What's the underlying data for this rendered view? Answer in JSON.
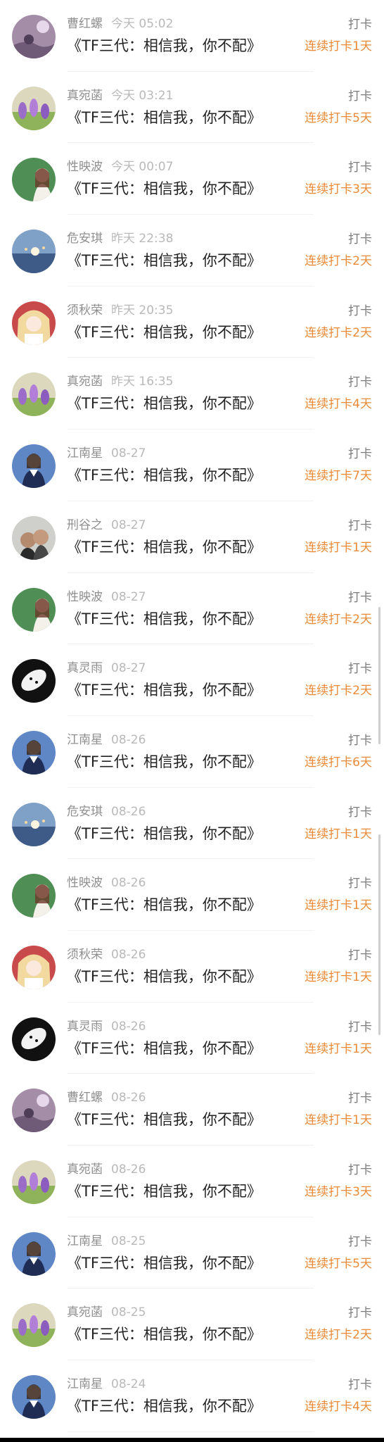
{
  "items": [
    {
      "name": "曹红螺",
      "time": "今天 05:02",
      "title": "《TF三代：相信我，你不配》",
      "action": "打卡",
      "streak": "连续打卡1天",
      "avatar": "avatar-purple-night-icon"
    },
    {
      "name": "真宛菡",
      "time": "今天 03:21",
      "title": "《TF三代：相信我，你不配》",
      "action": "打卡",
      "streak": "连续打卡5天",
      "avatar": "avatar-crocus-flowers-icon"
    },
    {
      "name": "性映波",
      "time": "今天 00:07",
      "title": "《TF三代：相信我，你不配》",
      "action": "打卡",
      "streak": "连续打卡3天",
      "avatar": "avatar-green-portrait-icon"
    },
    {
      "name": "危安琪",
      "time": "昨天 22:38",
      "title": "《TF三代：相信我，你不配》",
      "action": "打卡",
      "streak": "连续打卡2天",
      "avatar": "avatar-blue-sky-icon"
    },
    {
      "name": "须秋荣",
      "time": "昨天 20:35",
      "title": "《TF三代：相信我，你不配》",
      "action": "打卡",
      "streak": "连续打卡2天",
      "avatar": "avatar-anime-girl-icon"
    },
    {
      "name": "真宛菡",
      "time": "昨天 16:35",
      "title": "《TF三代：相信我，你不配》",
      "action": "打卡",
      "streak": "连续打卡4天",
      "avatar": "avatar-crocus-flowers-icon"
    },
    {
      "name": "江南星",
      "time": "08-27",
      "title": "《TF三代：相信我，你不配》",
      "action": "打卡",
      "streak": "连续打卡7天",
      "avatar": "avatar-uniform-girl-icon"
    },
    {
      "name": "刑谷之",
      "time": "08-27",
      "title": "《TF三代：相信我，你不配》",
      "action": "打卡",
      "streak": "连续打卡1天",
      "avatar": "avatar-couple-photo-icon"
    },
    {
      "name": "性映波",
      "time": "08-27",
      "title": "《TF三代：相信我，你不配》",
      "action": "打卡",
      "streak": "连续打卡2天",
      "avatar": "avatar-green-portrait-icon"
    },
    {
      "name": "真灵雨",
      "time": "08-27",
      "title": "《TF三代：相信我，你不配》",
      "action": "打卡",
      "streak": "连续打卡2天",
      "avatar": "avatar-black-white-icon"
    },
    {
      "name": "江南星",
      "time": "08-26",
      "title": "《TF三代：相信我，你不配》",
      "action": "打卡",
      "streak": "连续打卡6天",
      "avatar": "avatar-uniform-girl-icon"
    },
    {
      "name": "危安琪",
      "time": "08-26",
      "title": "《TF三代：相信我，你不配》",
      "action": "打卡",
      "streak": "连续打卡1天",
      "avatar": "avatar-blue-sky-icon"
    },
    {
      "name": "性映波",
      "time": "08-26",
      "title": "《TF三代：相信我，你不配》",
      "action": "打卡",
      "streak": "连续打卡1天",
      "avatar": "avatar-green-portrait-icon"
    },
    {
      "name": "须秋荣",
      "time": "08-26",
      "title": "《TF三代：相信我，你不配》",
      "action": "打卡",
      "streak": "连续打卡1天",
      "avatar": "avatar-anime-girl-icon"
    },
    {
      "name": "真灵雨",
      "time": "08-26",
      "title": "《TF三代：相信我，你不配》",
      "action": "打卡",
      "streak": "连续打卡1天",
      "avatar": "avatar-black-white-icon"
    },
    {
      "name": "曹红螺",
      "time": "08-26",
      "title": "《TF三代：相信我，你不配》",
      "action": "打卡",
      "streak": "连续打卡1天",
      "avatar": "avatar-purple-night-icon"
    },
    {
      "name": "真宛菡",
      "time": "08-26",
      "title": "《TF三代：相信我，你不配》",
      "action": "打卡",
      "streak": "连续打卡3天",
      "avatar": "avatar-crocus-flowers-icon"
    },
    {
      "name": "江南星",
      "time": "08-25",
      "title": "《TF三代：相信我，你不配》",
      "action": "打卡",
      "streak": "连续打卡5天",
      "avatar": "avatar-uniform-girl-icon"
    },
    {
      "name": "真宛菡",
      "time": "08-25",
      "title": "《TF三代：相信我，你不配》",
      "action": "打卡",
      "streak": "连续打卡2天",
      "avatar": "avatar-crocus-flowers-icon"
    },
    {
      "name": "江南星",
      "time": "08-24",
      "title": "《TF三代：相信我，你不配》",
      "action": "打卡",
      "streak": "连续打卡4天",
      "avatar": "avatar-uniform-girl-icon"
    }
  ],
  "colors": {
    "name": "#8f8f8f",
    "time": "#b9b9b9",
    "title": "#222222",
    "action": "#7d7d7d",
    "streak": "#ea8a37"
  }
}
